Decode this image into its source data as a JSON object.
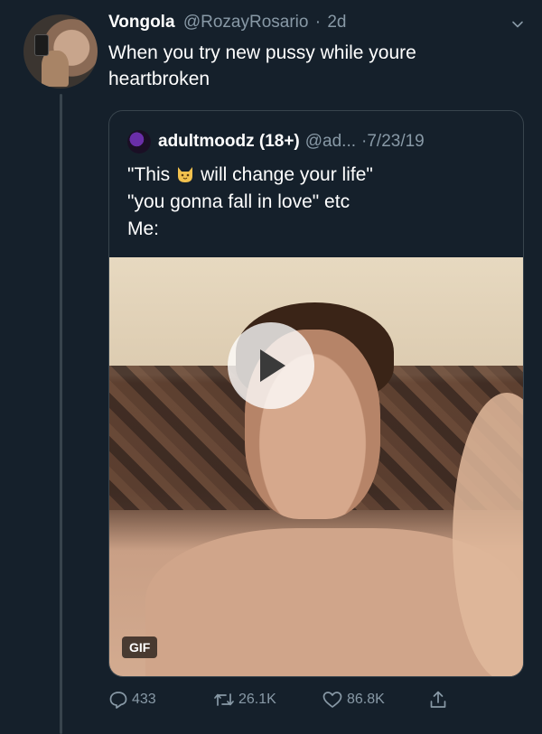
{
  "tweet": {
    "display_name": "Vongola",
    "handle": "@RozayRosario",
    "separator": "·",
    "time": "2d",
    "text": "When you try new pussy while youre heartbroken"
  },
  "quoted_tweet": {
    "display_name": "adultmoodz (18+)",
    "handle": "@ad...",
    "separator": "·",
    "date": "7/23/19",
    "line1_before": "\"This",
    "line1_after": "will change your life\"",
    "line2": "\"you gonna fall in love\" etc",
    "line3": "Me:",
    "media_badge": "GIF"
  },
  "actions": {
    "reply_count": "433",
    "retweet_count": "26.1K",
    "like_count": "86.8K"
  },
  "icons": {
    "caret": "chevron-down-icon",
    "reply": "reply-icon",
    "retweet": "retweet-icon",
    "like": "heart-icon",
    "share": "share-icon",
    "play": "play-icon",
    "emoji": "cat-face-emoji"
  },
  "colors": {
    "background": "#15202b",
    "secondary_text": "#8899a6",
    "border": "#38444d"
  }
}
